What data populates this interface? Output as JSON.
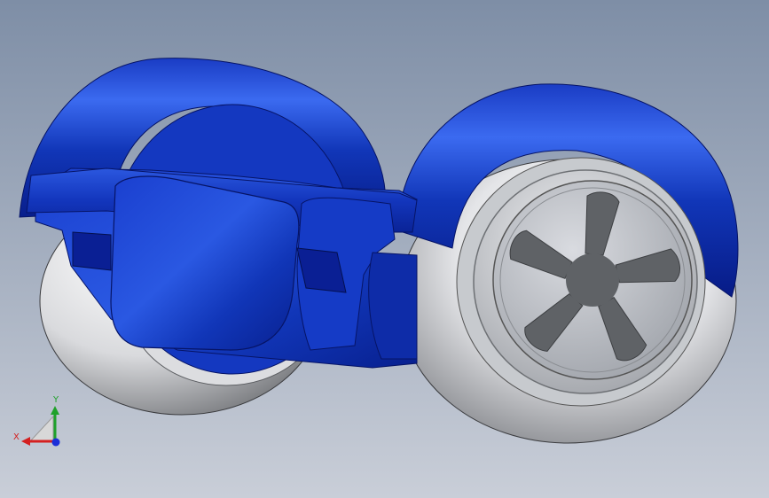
{
  "viewport": {
    "background_top": "#7e8ea6",
    "background_bottom": "#c9ced8"
  },
  "model": {
    "body_color": "#1136b8",
    "body_highlight": "#2e5fe6",
    "body_shadow": "#06167a",
    "tire_color": "#e9eaec",
    "tire_shadow": "#7d7f84",
    "hub_color": "#b8bcc2",
    "hub_dark": "#6d7074"
  },
  "triad": {
    "x_label": "X",
    "y_label": "Y",
    "x_color": "#d42020",
    "y_color": "#1fa12a",
    "z_color": "#1c2fd8"
  }
}
